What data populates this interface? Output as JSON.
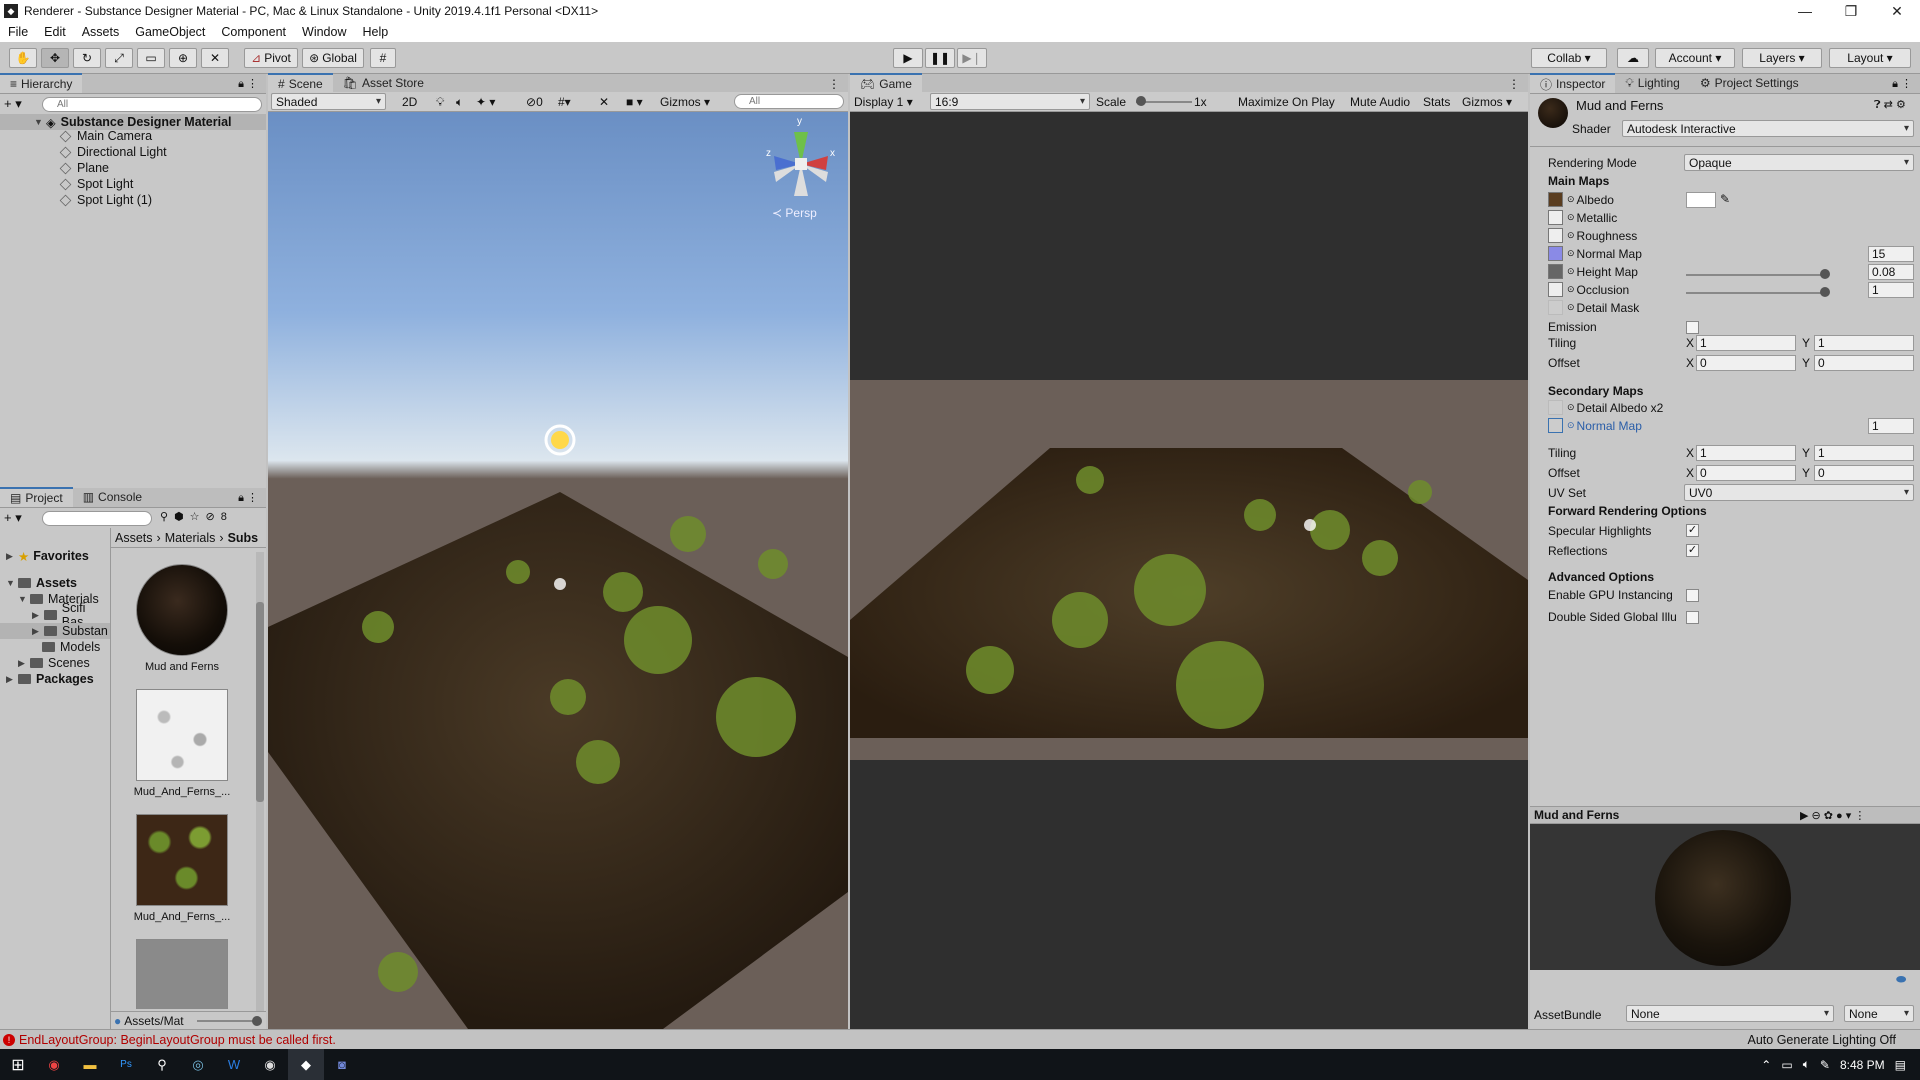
{
  "window": {
    "title": "Renderer - Substance Designer Material - PC, Mac & Linux Standalone - Unity 2019.4.1f1 Personal <DX11>",
    "min": "—",
    "max": "❐",
    "close": "✕"
  },
  "menu": [
    "File",
    "Edit",
    "Assets",
    "GameObject",
    "Component",
    "Window",
    "Help"
  ],
  "toolbar": {
    "pivot": "Pivot",
    "global": "Global",
    "collab": "Collab",
    "account": "Account",
    "layers": "Layers",
    "layout": "Layout"
  },
  "hierarchy": {
    "tab": "Hierarchy",
    "search_placeholder": "All",
    "scene": "Substance Designer Material",
    "items": [
      "Main Camera",
      "Directional Light",
      "Plane",
      "Spot Light",
      "Spot Light (1)"
    ]
  },
  "scene_view": {
    "tabs": [
      "Scene",
      "Asset Store"
    ],
    "shading": "Shaded",
    "mode2d": "2D",
    "fx_count": "0",
    "gizmos": "Gizmos",
    "search_placeholder": "All",
    "persp": "Persp",
    "axis_y": "y",
    "axis_x": "x",
    "axis_z": "z"
  },
  "game_view": {
    "tab": "Game",
    "display": "Display 1",
    "aspect": "16:9",
    "scale_label": "Scale",
    "scale_value": "1x",
    "maximize": "Maximize On Play",
    "mute": "Mute Audio",
    "stats": "Stats",
    "gizmos": "Gizmos"
  },
  "project": {
    "tabs": [
      "Project",
      "Console"
    ],
    "hidden_count": "8",
    "favorites": "Favorites",
    "assets": "Assets",
    "tree": [
      "Materials",
      "Scifi Bas",
      "Substan",
      "Models",
      "Scenes"
    ],
    "packages": "Packages",
    "breadcrumb": [
      "Assets",
      "Materials",
      "Subs"
    ],
    "thumbs": [
      "Mud and Ferns",
      "Mud_And_Ferns_...",
      "Mud_And_Ferns_..."
    ],
    "footer_path": "Assets/Mat"
  },
  "inspector": {
    "tabs": [
      "Inspector",
      "Lighting",
      "Project Settings"
    ],
    "material_name": "Mud and Ferns",
    "shader_label": "Shader",
    "shader_value": "Autodesk Interactive",
    "rendering_mode_label": "Rendering Mode",
    "rendering_mode_value": "Opaque",
    "main_maps": "Main Maps",
    "albedo": "Albedo",
    "metallic": "Metallic",
    "roughness": "Roughness",
    "normal_map": "Normal Map",
    "normal_value": "15",
    "height_map": "Height Map",
    "height_value": "0.08",
    "height_level": 1.0,
    "occlusion": "Occlusion",
    "occlusion_value": "1",
    "occlusion_level": 1.0,
    "detail_mask": "Detail Mask",
    "emission": "Emission",
    "tiling": "Tiling",
    "offset": "Offset",
    "x": "X",
    "y": "Y",
    "tiling_x": "1",
    "tiling_y": "1",
    "offset_x": "0",
    "offset_y": "0",
    "secondary_maps": "Secondary Maps",
    "detail_albedo": "Detail Albedo x2",
    "sec_normal_map": "Normal Map",
    "sec_normal_value": "1",
    "sec_tiling_x": "1",
    "sec_tiling_y": "1",
    "sec_offset_x": "0",
    "sec_offset_y": "0",
    "uv_set_label": "UV Set",
    "uv_set_value": "UV0",
    "forward_rendering": "Forward Rendering Options",
    "specular": "Specular Highlights",
    "reflections": "Reflections",
    "advanced": "Advanced Options",
    "gpu_instancing": "Enable GPU Instancing",
    "double_sided": "Double Sided Global Illu",
    "preview_title": "Mud and Ferns",
    "assetbundle_label": "AssetBundle",
    "assetbundle_value": "None",
    "assetbundle_variant": "None"
  },
  "status": {
    "error": "EndLayoutGroup: BeginLayoutGroup must be called first.",
    "right": "Auto Generate Lighting Off"
  },
  "taskbar": {
    "time": "8:48 PM",
    "apps": [
      "Chrome",
      "Explorer",
      "Ps",
      "Search",
      "Steam",
      "Word",
      "Media",
      "Unity",
      "Discord"
    ]
  },
  "colors": {
    "accent": "#3a72b0",
    "error": "#b00000",
    "sky_top": "#6a8fc4",
    "ground": "#6b5f58"
  }
}
